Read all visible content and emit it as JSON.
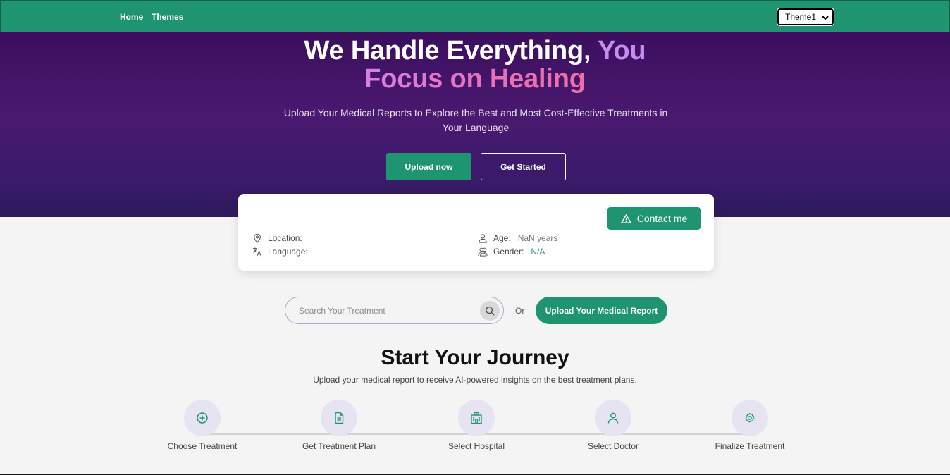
{
  "nav": {
    "home": "Home",
    "themes": "Themes",
    "theme_selected": "Theme1"
  },
  "hero": {
    "title_part1": "We Handle Everything, ",
    "title_part2": "You",
    "title_part3": "Focus on Healing",
    "subtitle": "Upload Your Medical Reports to Explore the Best and Most Cost-Effective Treatments in Your Language",
    "upload_button": "Upload now",
    "started_button": "Get Started"
  },
  "profile": {
    "contact_button": "Contact me",
    "location_label": "Location:",
    "location_value": "",
    "language_label": "Language:",
    "language_value": "",
    "age_label": "Age:",
    "age_value": "NaN years",
    "gender_label": "Gender:",
    "gender_value": "N/A"
  },
  "search": {
    "placeholder": "Search Your Treatment",
    "or_text": "Or",
    "upload_report_button": "Upload Your Medical Report"
  },
  "journey": {
    "title": "Start Your Journey",
    "subtitle": "Upload your medical report to receive AI-powered insights on the best treatment plans.",
    "steps": [
      {
        "label": "Choose Treatment",
        "icon": "plus-circle-icon"
      },
      {
        "label": "Get Treatment Plan",
        "icon": "document-icon"
      },
      {
        "label": "Select Hospital",
        "icon": "hospital-icon"
      },
      {
        "label": "Select Doctor",
        "icon": "user-icon"
      },
      {
        "label": "Finalize Treatment",
        "icon": "gear-icon"
      }
    ]
  },
  "colors": {
    "brand_green": "#1e9470",
    "hero_purple": "#4a1970",
    "accent_pink": "#e870b8",
    "accent_violet": "#c98bf0"
  }
}
